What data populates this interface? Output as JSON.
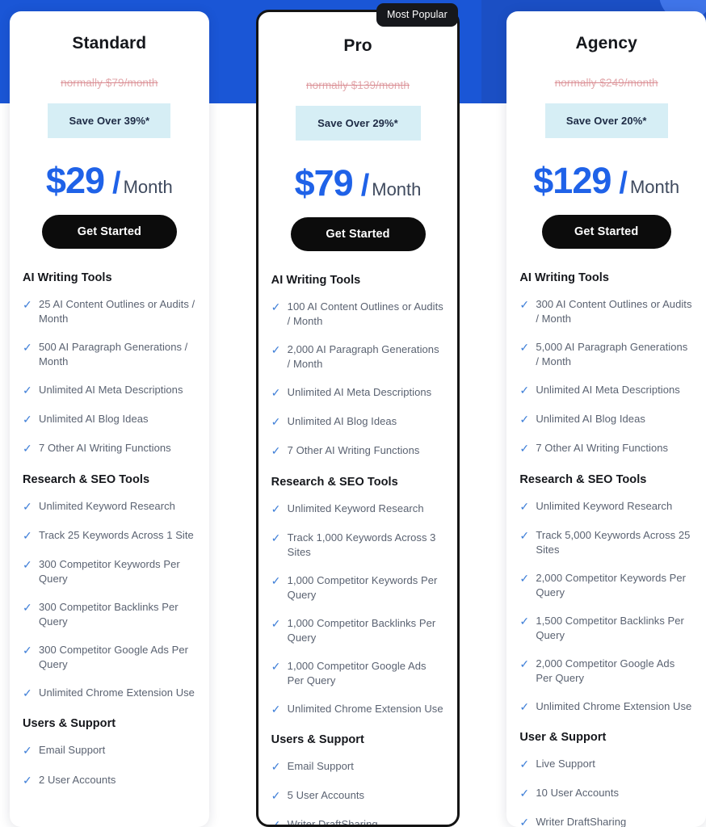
{
  "theme": {
    "brand_blue": "#1a56d6",
    "price_blue": "#1f62e8",
    "chip_bg": "#d6eef5",
    "cta_bg": "#0c0c0c",
    "check_color": "#3f7fd8",
    "strikethrough_color": "#e2a8ac"
  },
  "badge": {
    "label": "Most Popular"
  },
  "icons": {
    "check": "check-icon",
    "circle_decoration": "circle-decoration"
  },
  "plans": [
    {
      "name": "Standard",
      "normally": "normally $79/month",
      "save": "Save Over 39%*",
      "price": "$29",
      "slash": "/",
      "period": "Month",
      "cta": "Get Started",
      "groups": [
        {
          "title": "AI Writing Tools",
          "items": [
            "25 AI Content Outlines or Audits / Month",
            "500 AI Paragraph Generations / Month",
            "Unlimited AI Meta Descriptions",
            "Unlimited AI Blog Ideas",
            "7 Other AI Writing Functions"
          ]
        },
        {
          "title": "Research & SEO Tools",
          "items": [
            "Unlimited Keyword Research",
            "Track 25 Keywords Across 1 Site",
            "300 Competitor Keywords Per Query",
            "300 Competitor Backlinks Per Query",
            "300 Competitor Google Ads Per Query",
            "Unlimited Chrome Extension Use"
          ]
        },
        {
          "title": "Users & Support",
          "items": [
            "Email Support",
            "2 User Accounts"
          ]
        }
      ]
    },
    {
      "name": "Pro",
      "normally": "normally $139/month",
      "save": "Save Over 29%*",
      "price": "$79",
      "slash": "/",
      "period": "Month",
      "cta": "Get Started",
      "groups": [
        {
          "title": "AI Writing Tools",
          "items": [
            "100 AI Content Outlines or Audits / Month",
            "2,000 AI Paragraph Generations / Month",
            "Unlimited AI Meta Descriptions",
            "Unlimited AI Blog Ideas",
            "7 Other AI Writing Functions"
          ]
        },
        {
          "title": "Research & SEO Tools",
          "items": [
            "Unlimited Keyword Research",
            "Track 1,000 Keywords Across 3 Sites",
            "1,000 Competitor Keywords Per Query",
            "1,000 Competitor Backlinks Per Query",
            "1,000 Competitor Google Ads Per Query",
            "Unlimited Chrome Extension Use"
          ]
        },
        {
          "title": "Users & Support",
          "items": [
            "Email Support",
            "5 User Accounts",
            "Writer DraftSharing"
          ]
        }
      ]
    },
    {
      "name": "Agency",
      "normally": "normally $249/month",
      "save": "Save Over 20%*",
      "price": "$129",
      "slash": "/",
      "period": "Month",
      "cta": "Get Started",
      "groups": [
        {
          "title": "AI Writing Tools",
          "items": [
            "300 AI Content Outlines or Audits / Month",
            "5,000 AI Paragraph Generations / Month",
            "Unlimited AI Meta Descriptions",
            "Unlimited AI Blog Ideas",
            "7 Other AI Writing Functions"
          ]
        },
        {
          "title": "Research & SEO Tools",
          "items": [
            "Unlimited Keyword Research",
            "Track 5,000 Keywords Across 25 Sites",
            "2,000 Competitor Keywords Per Query",
            "1,500 Competitor Backlinks Per Query",
            "2,000 Competitor Google Ads Per Query",
            "Unlimited Chrome Extension Use"
          ]
        },
        {
          "title": "User & Support",
          "items": [
            "Live Support",
            "10 User Accounts",
            "Writer DraftSharing"
          ]
        }
      ]
    }
  ]
}
